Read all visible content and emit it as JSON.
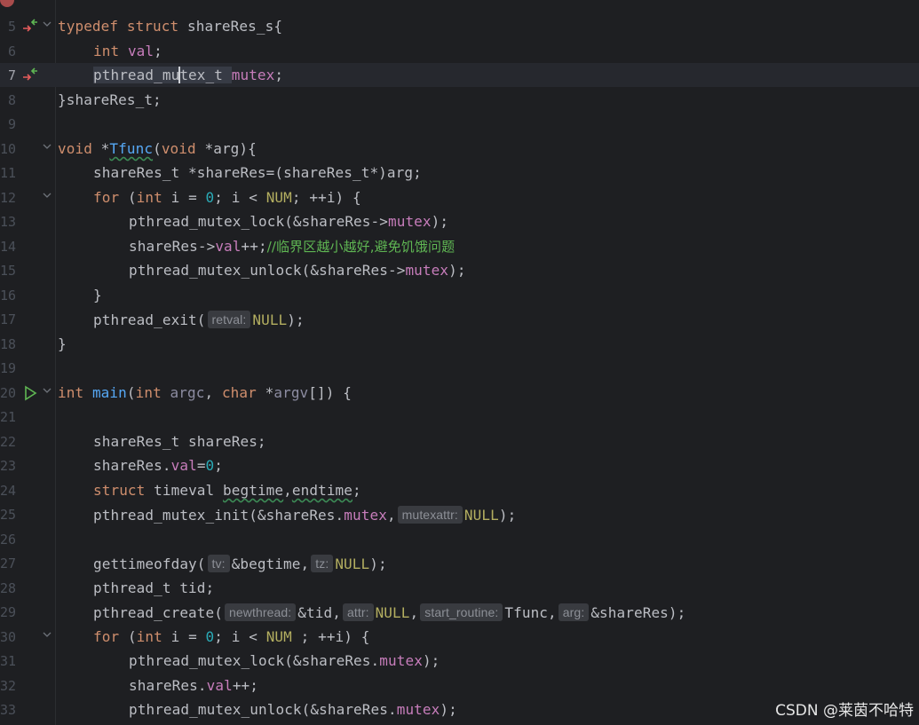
{
  "line_numbers": [
    "5",
    "6",
    "7",
    "8",
    "9",
    "10",
    "11",
    "12",
    "13",
    "14",
    "15",
    "16",
    "17",
    "18",
    "19",
    "20",
    "21",
    "22",
    "23",
    "24",
    "25",
    "26",
    "27",
    "28",
    "29",
    "30",
    "31",
    "32",
    "33"
  ],
  "code": {
    "l5_a": "typedef struct ",
    "l5_b": "shareRes_s{",
    "l6_a": "int ",
    "l6_b": "val",
    "l6_c": ";",
    "l7_a": "pthread_mu",
    "l7_b": "tex_t ",
    "l7_c": "mutex",
    "l7_d": ";",
    "l8": "}shareRes_t;",
    "l10_a": "void ",
    "l10_b": "*",
    "l10_c": "Tfunc",
    "l10_d": "(",
    "l10_e": "void ",
    "l10_f": "*arg){",
    "l11": "shareRes_t *shareRes=(shareRes_t*)arg;",
    "l12_a": "for ",
    "l12_b": "(",
    "l12_c": "int ",
    "l12_d": "i = ",
    "l12_e": "0",
    "l12_f": "; i < ",
    "l12_g": "NUM",
    "l12_h": "; ++i) {",
    "l13_a": "pthread_mutex_lock(&shareRes->",
    "l13_b": "mutex",
    "l13_c": ");",
    "l14_a": "shareRes->",
    "l14_b": "val",
    "l14_c": "++;",
    "l14_d": "//临界区越小越好,避免饥饿问题",
    "l15_a": "pthread_mutex_unlock(&shareRes->",
    "l15_b": "mutex",
    "l15_c": ");",
    "l16": "}",
    "l17_a": "pthread_exit(",
    "l17_hint": "retval:",
    "l17_b": "NULL",
    "l17_c": ");",
    "l18": "}",
    "l20_a": "int ",
    "l20_b": "main",
    "l20_c": "(",
    "l20_d": "int ",
    "l20_e": "argc",
    "l20_f": ", ",
    "l20_g": "char ",
    "l20_h": "*",
    "l20_i": "argv",
    "l20_j": "[]) {",
    "l22": "shareRes_t shareRes;",
    "l23_a": "shareRes.",
    "l23_b": "val",
    "l23_c": "=",
    "l23_d": "0",
    "l23_e": ";",
    "l24_a": "struct ",
    "l24_b": "timeval ",
    "l24_c": "begtime",
    "l24_d": ",",
    "l24_e": "endtime",
    "l24_f": ";",
    "l25_a": "pthread_mutex_init(&shareRes.",
    "l25_b": "mutex",
    "l25_c": ",",
    "l25_hint": "mutexattr:",
    "l25_d": "NULL",
    "l25_e": ");",
    "l27_a": "gettimeofday(",
    "l27_hint1": "tv:",
    "l27_b": "&begtime,",
    "l27_hint2": "tz:",
    "l27_c": "NULL",
    "l27_d": ");",
    "l28": "pthread_t tid;",
    "l29_a": "pthread_create(",
    "l29_hint1": "newthread:",
    "l29_b": "&tid,",
    "l29_hint2": "attr:",
    "l29_c": "NULL",
    "l29_d": ",",
    "l29_hint3": "start_routine:",
    "l29_e": "Tfunc,",
    "l29_hint4": "arg:",
    "l29_f": "&shareRes);",
    "l30_a": "for ",
    "l30_b": "(",
    "l30_c": "int ",
    "l30_d": "i = ",
    "l30_e": "0",
    "l30_f": "; i < ",
    "l30_g": "NUM",
    "l30_h": " ; ++i) {",
    "l31_a": "pthread_mutex_lock(&shareRes.",
    "l31_b": "mutex",
    "l31_c": ");",
    "l32_a": "shareRes.",
    "l32_b": "val",
    "l32_c": "++;",
    "l33_a": "pthread_mutex_unlock(&shareRes.",
    "l33_b": "mutex",
    "l33_c": ");"
  },
  "watermark": "CSDN @莱茵不哈特",
  "colors": {
    "background": "#1e1f22",
    "keyword": "#cf8e6d",
    "function": "#56a8f5",
    "field": "#c77dbb",
    "number": "#2aacb8",
    "macro": "#b3ae60",
    "comment": "#5fb653"
  },
  "icons": {
    "implements": "implements-arrow-icon",
    "run": "run-gutter-icon",
    "fold": "fold-chevron-icon"
  }
}
